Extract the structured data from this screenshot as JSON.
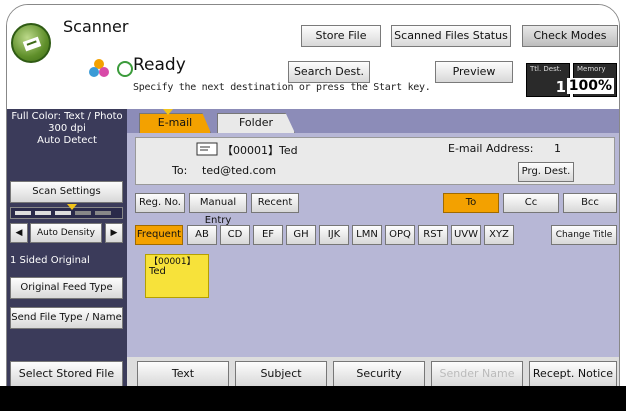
{
  "app": {
    "title": "Scanner",
    "status": "Ready",
    "status_hint": "Specify the next destination or press the Start key."
  },
  "header": {
    "store_file": "Store File",
    "scanned_files_status": "Scanned Files Status",
    "check_modes": "Check Modes",
    "search_dest": "Search Dest.",
    "preview": "Preview",
    "total_dest_label": "Ttl. Dest.",
    "total_dest_value": "1",
    "memory_label": "Memory",
    "memory_value": "100%"
  },
  "left": {
    "scan_info_line1": "Full Color: Text / Photo",
    "scan_info_line2": "300 dpi",
    "scan_info_line3": "Auto Detect",
    "scan_settings": "Scan Settings",
    "auto_density": "Auto Density",
    "original_sides": "1 Sided Original",
    "original_feed_type": "Original Feed Type",
    "send_file_type": "Send File Type / Name",
    "select_stored_file": "Select Stored File"
  },
  "tabs": {
    "email": "E-mail",
    "folder": "Folder"
  },
  "destination": {
    "entry": "【00001】Ted",
    "to_label": "To:",
    "to_value": "ted@ted.com",
    "address_label": "E-mail Address:",
    "address_count": "1",
    "prg_dest": "Prg. Dest."
  },
  "entry_row": {
    "reg_no": "Reg. No.",
    "manual_entry": "Manual Entry",
    "recent": "Recent",
    "to": "To",
    "cc": "Cc",
    "bcc": "Bcc"
  },
  "index_row": {
    "frequent": "Frequent",
    "keys": [
      "AB",
      "CD",
      "EF",
      "GH",
      "IJK",
      "LMN",
      "OPQ",
      "RST",
      "UVW",
      "XYZ"
    ],
    "change_title": "Change Title"
  },
  "dest_card": {
    "number": "【00001】",
    "name": "Ted"
  },
  "bottom": {
    "text": "Text",
    "subject": "Subject",
    "security": "Security",
    "sender_name": "Sender Name",
    "recept_notice": "Recept. Notice"
  },
  "colors": {
    "accent": "#f3a100",
    "panel": "#b7b7d6",
    "left_panel": "#3b3b5a",
    "card": "#f7e23a"
  }
}
